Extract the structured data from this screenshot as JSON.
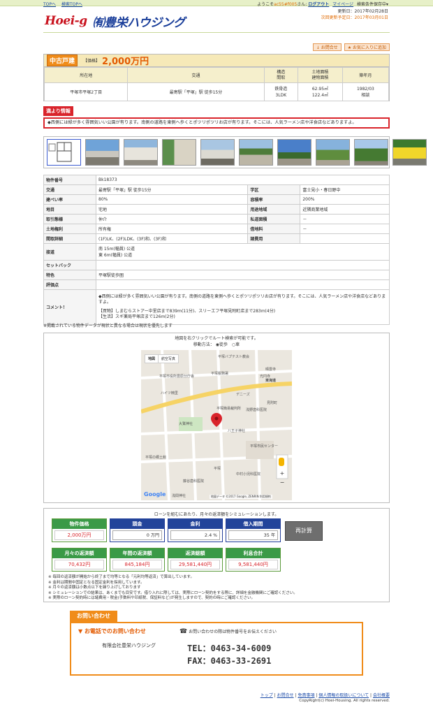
{
  "nav": {
    "links": [
      "TOPへ",
      "検索TOPへ"
    ]
  },
  "user": {
    "greeting": "ようこそ",
    "name": "ac55#f005",
    "suffix": "さん: ",
    "logout": "ログアウト",
    "mypage": "マイページ",
    "search": "検索条件保存中"
  },
  "logo": {
    "l1": "Hoei-g",
    "l2": "㈲豊栄ハウジング"
  },
  "updates": {
    "line1": "更新日：2017年02月28日",
    "line2": "次回更新予定日：2017年03月01日"
  },
  "actions": {
    "inquiry": "↓ お問合せ",
    "favorite": "★ お気に入りに追加"
  },
  "summary": {
    "category": "中古戸建",
    "price_label": "【価格】",
    "price": "2,000万円",
    "headers": [
      "所在地",
      "交通",
      "構造\n間取",
      "土地面積\n建物面積",
      "築年月"
    ],
    "row": [
      "平塚市平塚2丁目",
      "最寄駅「平塚」駅 徒歩15分",
      "鉄骨造\n3LDK",
      "62.95㎡\n122.4㎡",
      "1982/03\n相談"
    ]
  },
  "osusume": {
    "tag": "満より情報",
    "text": "◆西側には緑が多く雰囲気いい公園が有ります。南側の道路を東側へ歩くとポツリポツリお店が有ります。そこには、人気ラーメン店や洋食店などありますよ。"
  },
  "details": {
    "物件番号": "Bk18373",
    "交通": "最寄駅「平塚」駅 徒歩15分",
    "学区": "富士見小・春日野中",
    "建ぺい率": "80%",
    "容積率": "200%",
    "地目": "宅地",
    "用途地域": "近隣商業地域",
    "取引態様": "仲介",
    "私道面積": "－",
    "土地権利": "所有権",
    "借地料": "－",
    "間取詳細": "(1F)LK、(2F)LDK、(3F)和、(3F)和",
    "諸費用": "",
    "接道1": "南 15m(幅員) 公道",
    "接道2": "東 6m(幅員) 公道",
    "セットバック": "",
    "特色": "平塚駅徒歩圏",
    "評価点": "",
    "comment1": "◆西側には緑が多く雰囲気いい公園が有ります。南側の道路を東側へ歩くとポツリポツリお店が有ります。そこには、人気ラーメン店や洋食店などありますよ。",
    "comment2": "【買物】しまむらストアー中里店まで839m(11分)、スリーエフ平塚見附町店まで283m(4分)",
    "comment3": "【生活】スギ薬局平塚店まで126m(2分)"
  },
  "detail_labels": {
    "no": "物件番号",
    "kotsu": "交通",
    "gakku": "学区",
    "kenpei": "建ぺい率",
    "yoseki": "容積率",
    "chimoku": "地目",
    "yoto": "用途地域",
    "torihiki": "取引態様",
    "shido": "私道面積",
    "kenri": "土地権利",
    "shakuchi": "借地料",
    "madori": "間取詳細",
    "shohi": "諸費用",
    "setsudo": "接道",
    "setback": "セットバック",
    "tokushoku": "特色",
    "hyoka": "評価点",
    "comment": "コメント！"
  },
  "note1": "※掲載されている物件データが現状と異なる場合は現状を優先します",
  "map": {
    "line1": "地図を右クリックでルート検索が可能です。",
    "method_label": "移動方法：",
    "walk": "徒歩",
    "car": "車",
    "maptype1": "地図",
    "maptype2": "航空写真",
    "credit": "地図データ ©2017 Google, ZENRIN 利用規約",
    "google": "Google",
    "labels": [
      "平塚バプテスト教会",
      "晴雲寺",
      "平塚市役所豊原分庁舎",
      "光円寺",
      "ハイツ楠里",
      "デニーズ",
      "見附町",
      "平塚簡易裁判所",
      "浅野歯科医院",
      "大鷲神社",
      "八王子神社",
      "平塚市民センター",
      "平塚の郷土館",
      "中村小児科医院",
      "藤谷歯科医院",
      "浅間神社",
      "東海道",
      "平塚",
      "平塚税務署"
    ]
  },
  "loan": {
    "head": "ローンを組むにあたり、月々の返済額をシミュレーションします。",
    "price_label": "物件価格",
    "price_value": "2,000万円",
    "down_label": "頭金",
    "down_value": "0",
    "down_unit": "万円",
    "rate_label": "金利",
    "rate_value": "2.4",
    "rate_unit": "%",
    "term_label": "借入期間",
    "term_value": "35",
    "term_unit": "年",
    "calc_button": "再計算",
    "monthly_label": "月々の返済額",
    "monthly": "70,432円",
    "bonus_label": "年間の返済額",
    "bonus": "845,184円",
    "total_label": "返済総額",
    "total": "29,581,440円",
    "interest_label": "利息合計",
    "interest": "9,581,440円",
    "notes": [
      "※ 毎回の返済額が開始から終了まで均等となる「元利均等返済」で算出しています。",
      "※ 金利は期間中固定となる固定金利を採用しています。",
      "※ 月々の返済額は小数点以下を繰り上げしております",
      "※ シミュレーションでの結果は、あくまでも目安です。借り入れに際しては、実際にローン契約をする際に、詳細を金融機関にご確認ください。",
      "※ 実際のローン契約時には諸費用・税金(手数料や印紙税、保証料など)が発生しますので、契約の時にご確認ください。"
    ]
  },
  "contact": {
    "tab": "お問い合わせ",
    "title": "▼ お電話でのお問い合わせ",
    "note": "お問い合わせの際は物件番号をお伝えください",
    "company": "有限会社豊栄ハウジング",
    "tel": "TEL：0463-34-6009",
    "fax": "FAX：0463-33-2691"
  },
  "footer": {
    "links": [
      "トップ",
      "お問合せ",
      "免責事項",
      "個人情報の取扱いについて",
      "会社概要"
    ],
    "copyright": "CopyRight(c) Hoei-Housing. All rights reserved."
  }
}
